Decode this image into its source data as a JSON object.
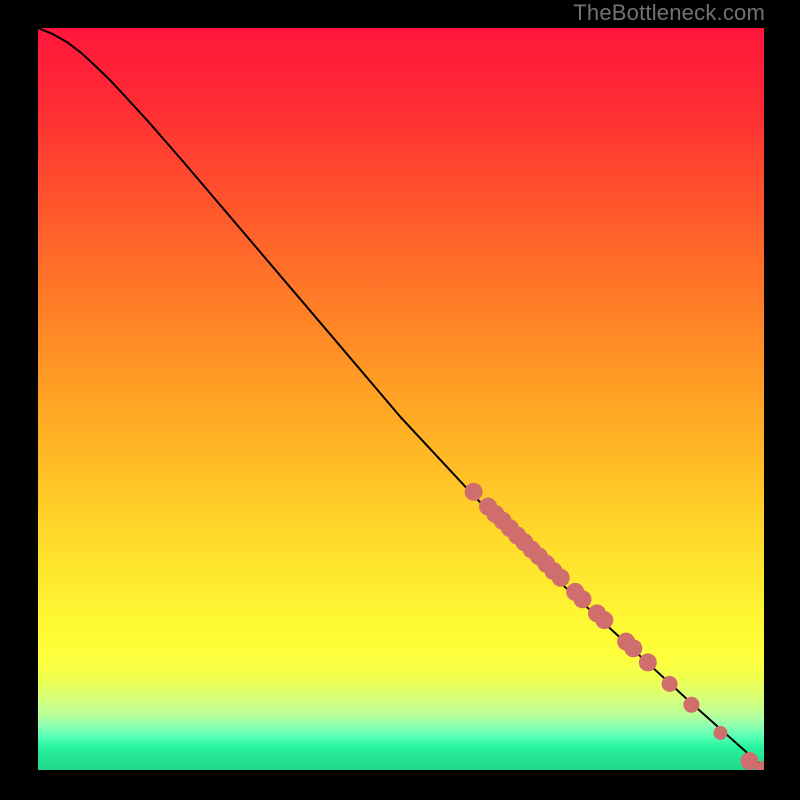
{
  "watermark": "TheBottleneck.com",
  "colors": {
    "point_fill": "#cf6e6c",
    "curve_stroke": "#000000",
    "background_stops": [
      {
        "offset": 0.0,
        "color": "#ff163cff"
      },
      {
        "offset": 0.1,
        "color": "#ff2b34"
      },
      {
        "offset": 0.2,
        "color": "#ff4a2e"
      },
      {
        "offset": 0.3,
        "color": "#ff682a"
      },
      {
        "offset": 0.4,
        "color": "#ff8526"
      },
      {
        "offset": 0.5,
        "color": "#ffa324"
      },
      {
        "offset": 0.6,
        "color": "#ffc026"
      },
      {
        "offset": 0.7,
        "color": "#ffde2b"
      },
      {
        "offset": 0.78,
        "color": "#fff332"
      },
      {
        "offset": 0.82,
        "color": "#fffc36"
      },
      {
        "offset": 0.85,
        "color": "#fdff3d"
      },
      {
        "offset": 0.875,
        "color": "#f1ff4e"
      },
      {
        "offset": 0.9,
        "color": "#daff73"
      },
      {
        "offset": 0.925,
        "color": "#baff99"
      },
      {
        "offset": 0.94,
        "color": "#8fffb1"
      },
      {
        "offset": 0.955,
        "color": "#56ffb4"
      },
      {
        "offset": 0.97,
        "color": "#27f39d"
      },
      {
        "offset": 0.985,
        "color": "#24e392"
      },
      {
        "offset": 1.0,
        "color": "#22d98c"
      }
    ]
  },
  "chart_data": {
    "type": "line",
    "title": "",
    "xlabel": "",
    "ylabel": "",
    "xlim": [
      0,
      100
    ],
    "ylim": [
      0,
      100
    ],
    "grid": false,
    "legend": false,
    "curve": {
      "name": "curve",
      "x": [
        0,
        2,
        4,
        6,
        8,
        10,
        12,
        15,
        20,
        30,
        40,
        50,
        60,
        70,
        80,
        90,
        100
      ],
      "y": [
        100,
        99.2,
        98.1,
        96.6,
        94.8,
        92.9,
        90.8,
        87.6,
        82.0,
        70.5,
        59.0,
        47.5,
        37.0,
        27.0,
        18.0,
        9.0,
        0.3
      ]
    },
    "series": [
      {
        "name": "points",
        "x": [
          60,
          62,
          63,
          64,
          65,
          66,
          67,
          68,
          69,
          70,
          71,
          72,
          74,
          75,
          77,
          78,
          81,
          82,
          84,
          87,
          90,
          94,
          98,
          100
        ],
        "y": [
          37.5,
          35.5,
          34.5,
          33.6,
          32.6,
          31.6,
          30.7,
          29.7,
          28.8,
          27.8,
          26.8,
          25.9,
          24.0,
          23.0,
          21.1,
          20.2,
          17.3,
          16.4,
          14.5,
          11.6,
          8.8,
          5.0,
          1.2,
          0.0
        ],
        "r": [
          9,
          9,
          9,
          9,
          9,
          9,
          9,
          9,
          9,
          9,
          9,
          9,
          9,
          9,
          9,
          9,
          9,
          9,
          9,
          8,
          8,
          7,
          9,
          9
        ]
      }
    ]
  }
}
